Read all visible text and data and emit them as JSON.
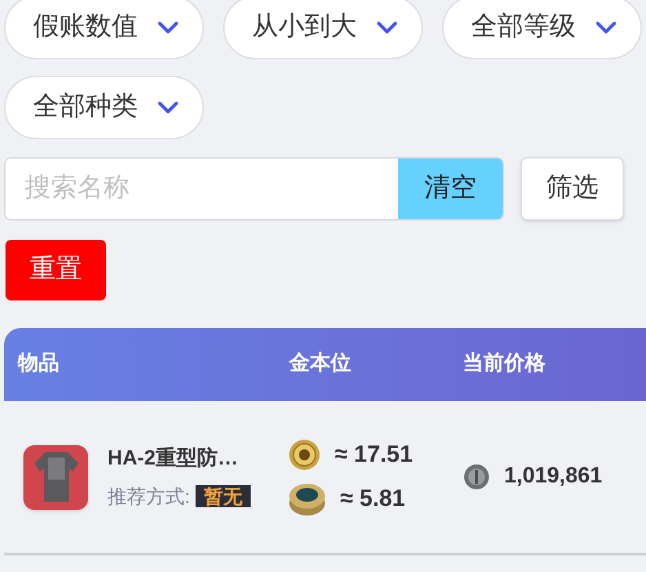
{
  "filters": [
    {
      "label": "假账数值"
    },
    {
      "label": "从小到大"
    },
    {
      "label": "全部等级"
    },
    {
      "label": "全部种类"
    }
  ],
  "search": {
    "placeholder": "搜索名称",
    "clear_button": "清空"
  },
  "filter_button": "筛选",
  "reset_button": "重置",
  "table": {
    "columns": [
      "物品",
      "金本位",
      "当前价格"
    ],
    "rows": [
      {
        "name": "HA-2重型防…",
        "recommend_label": "推荐方式:",
        "recommend_value": "暂无",
        "gold": [
          {
            "kind": "gold-coin",
            "text": "≈ 17.51"
          },
          {
            "kind": "bronze-coin",
            "text": "≈ 5.81"
          }
        ],
        "price": "1,019,861"
      }
    ]
  }
}
